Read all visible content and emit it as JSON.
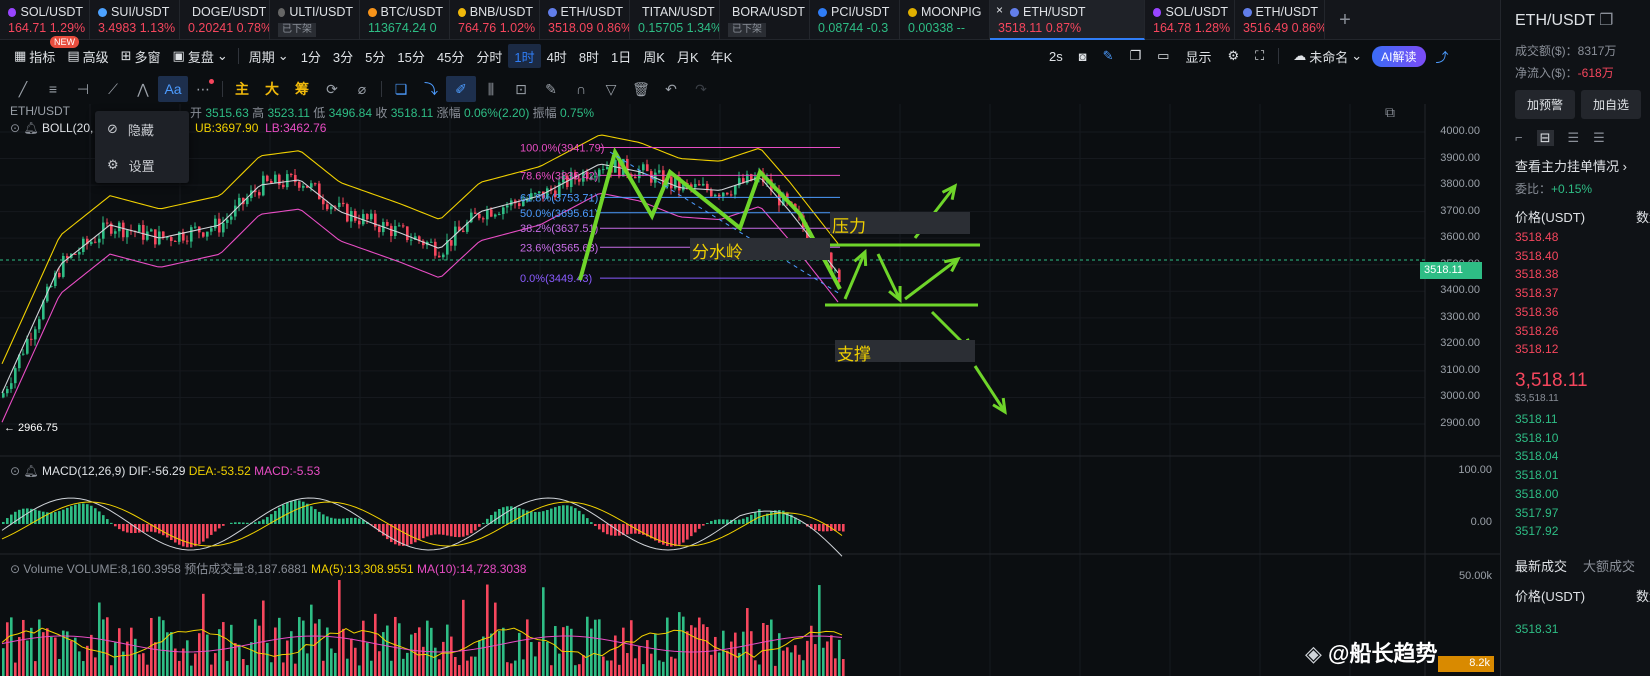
{
  "tabs": [
    {
      "sym": "SOL/USDT",
      "price": "164.71",
      "chg": "1.29%",
      "color": "red",
      "icon": "#9945ff"
    },
    {
      "sym": "SUI/USDT",
      "price": "3.4983",
      "chg": "1.13%",
      "color": "red",
      "icon": "#4da2ff"
    },
    {
      "sym": "DOGE/USDT",
      "price": "0.20241",
      "chg": "0.78%",
      "color": "red",
      "icon": "#c2a633"
    },
    {
      "sym": "ULTI/USDT",
      "price": "",
      "chg": "",
      "badge": "已下架",
      "color": "white",
      "icon": "#666"
    },
    {
      "sym": "BTC/USDT",
      "price": "113674.24",
      "chg": "0",
      "color": "green",
      "icon": "#f7931a"
    },
    {
      "sym": "BNB/USDT",
      "price": "764.76",
      "chg": "1.02%",
      "color": "red",
      "icon": "#f0b90b"
    },
    {
      "sym": "ETH/USDT",
      "price": "3518.09",
      "chg": "0.86%",
      "color": "red",
      "icon": "#627eea"
    },
    {
      "sym": "TITAN/USDT",
      "price": "0.15705",
      "chg": "1.34%",
      "color": "green",
      "icon": "#c8a000"
    },
    {
      "sym": "BORA/USDT",
      "price": "",
      "chg": "",
      "badge": "已下架",
      "color": "white",
      "icon": "#666"
    },
    {
      "sym": "PCI/USDT",
      "price": "0.08744",
      "chg": "-0.3",
      "color": "green",
      "icon": "#2f7df6"
    },
    {
      "sym": "MOONPIG",
      "price": "0.00338",
      "chg": "--",
      "color": "green",
      "icon": "#e0b000"
    },
    {
      "sym": "ETH/USDT",
      "price": "3518.11",
      "chg": "0.87%",
      "color": "red",
      "icon": "#627eea",
      "active": true
    },
    {
      "sym": "SOL/USDT",
      "price": "164.78",
      "chg": "1.28%",
      "color": "red",
      "icon": "#9945ff"
    },
    {
      "sym": "ETH/USDT",
      "price": "3516.49",
      "chg": "0.86%",
      "color": "red",
      "icon": "#627eea"
    }
  ],
  "tab_add": "+",
  "toolbar": {
    "indicator": "指标",
    "new": "NEW",
    "advanced": "高级",
    "multi": "多窗",
    "replay": "复盘",
    "period": "周期",
    "intervals": [
      "1分",
      "3分",
      "5分",
      "15分",
      "45分",
      "分时",
      "1时",
      "4时",
      "8时",
      "1日",
      "周K",
      "月K",
      "年K"
    ],
    "active_interval": "1时",
    "speed": "2s",
    "display": "显示",
    "unnamed": "未命名",
    "ai": "AI解读"
  },
  "draw": {
    "main": "主",
    "big": "大",
    "chip": "筹"
  },
  "ohlc": {
    "pair": "ETH/USDT",
    "open_l": "开",
    "open": "3515.63",
    "high_l": "高",
    "high": "3523.11",
    "low_l": "低",
    "low": "3496.84",
    "close_l": "收",
    "close": "3518.11",
    "chg_l": "涨幅",
    "chg": "0.06%(2.20)",
    "amp_l": "振幅",
    "amp": "0.75%"
  },
  "boll": {
    "label": "BOLL(20,",
    "ub": "UB:3697.90",
    "lb": "LB:3462.76"
  },
  "menu": {
    "hide": "隐藏",
    "settings": "设置"
  },
  "fib": [
    {
      "label": "100.0%(3941.79)",
      "color": "#e84dc4",
      "value": 3941.79
    },
    {
      "label": "78.6%(3836.42)",
      "color": "#e84dc4",
      "value": 3836.42
    },
    {
      "label": "61.8%(3753.71)",
      "color": "#4d9cff",
      "value": 3753.71
    },
    {
      "label": "50.0%(3695.61)",
      "color": "#4d9cff",
      "value": 3695.61
    },
    {
      "label": "38.2%(3637.51)",
      "color": "#c86de8",
      "value": 3637.51
    },
    {
      "label": "23.6%(3565.63)",
      "color": "#c86de8",
      "value": 3565.63
    },
    {
      "label": "0.0%(3449.43)",
      "color": "#8a5bff",
      "value": 3449.43
    }
  ],
  "annot": {
    "pressure": "压力",
    "watershed": "分水岭",
    "support": "支撑",
    "low_mark": "← 2966.75"
  },
  "price_axis": [
    "4000.00",
    "3900.00",
    "3800.00",
    "3700.00",
    "3600.00",
    "3500.00",
    "3400.00",
    "3300.00",
    "3200.00",
    "3100.00",
    "3000.00",
    "2900.00"
  ],
  "last_price": "3518.11",
  "macd": {
    "label": "MACD(12,26,9)",
    "dif": "DIF:-56.29",
    "dea": "DEA:-53.52",
    "macd": "MACD:-5.53",
    "axis_top": "100.00",
    "axis_zero": "0.00"
  },
  "vol": {
    "label": "Volume",
    "volume": "VOLUME:8,160.3958",
    "est": "预估成交量:8,187.6881",
    "ma5": "MA(5):13,308.9551",
    "ma10": "MA(10):14,728.3038",
    "axis": "50.00k",
    "last": "8.2k"
  },
  "watermark": "@船长趋势",
  "panel": {
    "title": "ETH/USDT",
    "turnover": "成交额($)：8317万",
    "inflow_l": "净流入($)：",
    "inflow": "-618万",
    "alert": "加预警",
    "watch": "加自选",
    "orders": "查看主力挂单情况",
    "ratio_l": "委比：",
    "ratio": "+0.15%",
    "price_h": "价格(USDT)",
    "qty_h": "数量",
    "asks": [
      "3518.48",
      "3518.40",
      "3518.38",
      "3518.37",
      "3518.36",
      "3518.26",
      "3518.12"
    ],
    "mid": "3,518.11",
    "mid_usd": "$3,518.11",
    "bids": [
      "3518.11",
      "3518.10",
      "3518.04",
      "3518.01",
      "3518.00",
      "3517.97",
      "3517.92"
    ],
    "latest": "最新成交",
    "big": "大额成交",
    "price_h2": "价格(USDT)",
    "qty_h2": "数量",
    "trade": "3518.31"
  }
}
